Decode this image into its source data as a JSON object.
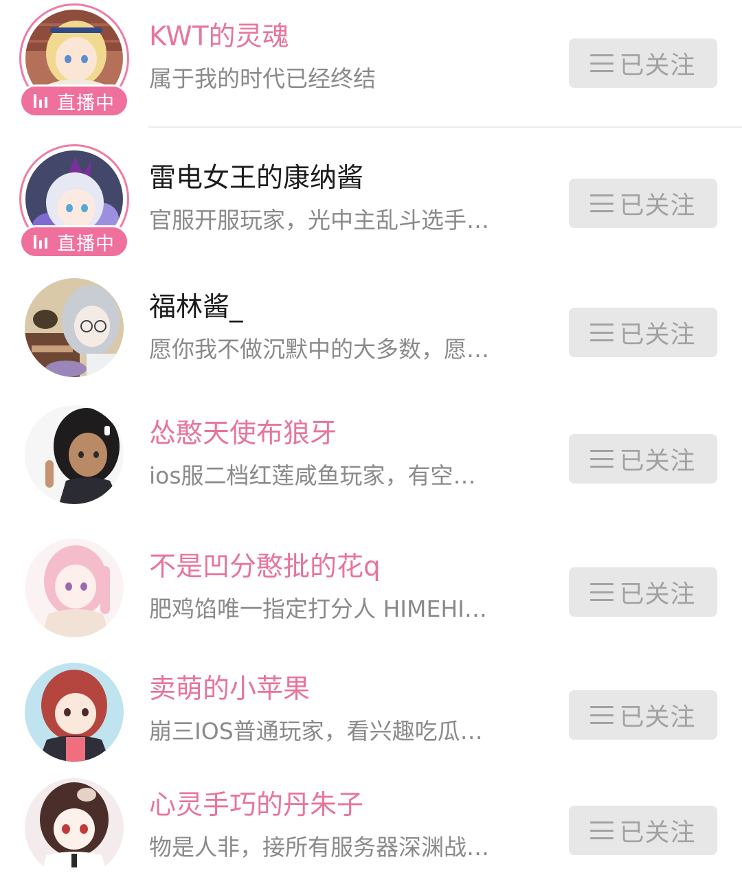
{
  "follow_list": {
    "live_badge_label": "直播中",
    "users": [
      {
        "name": "KWT的灵魂",
        "bio": "属于我的时代已经终结",
        "name_color": "#e8749d",
        "is_live": true,
        "follow_label": "已关注",
        "avatar": "avatar-anime-blonde-girl"
      },
      {
        "name": "雷电女王的康纳酱",
        "bio": "官服开服玩家，光中主乱斗选手…",
        "name_color": "#1c1c1c",
        "is_live": true,
        "follow_label": "已关注",
        "avatar": "avatar-anime-white-hair-girl"
      },
      {
        "name": "福林酱_",
        "bio": "愿你我不做沉默中的大多数，愿…",
        "name_color": "#1c1c1c",
        "is_live": false,
        "follow_label": "已关注",
        "avatar": "avatar-anime-silver-hair-glasses"
      },
      {
        "name": "怂憨天使布狼牙",
        "bio": "ios服二档红莲咸鱼玩家，有空…",
        "name_color": "#e8749d",
        "is_live": false,
        "follow_label": "已关注",
        "avatar": "avatar-anime-dark-skin-girl"
      },
      {
        "name": "不是凹分憨批的花q",
        "bio": "肥鸡馅唯一指定打分人 HIMEHI…",
        "name_color": "#e8749d",
        "is_live": false,
        "follow_label": "已关注",
        "avatar": "avatar-anime-pink-hair-girl"
      },
      {
        "name": "卖萌的小苹果",
        "bio": "崩三IOS普通玩家，看兴趣吃瓜…",
        "name_color": "#e8749d",
        "is_live": false,
        "follow_label": "已关注",
        "avatar": "avatar-anime-red-hair-girl"
      },
      {
        "name": "心灵手巧的丹朱子",
        "bio": "物是人非，接所有服务器深渊战…",
        "name_color": "#e8749d",
        "is_live": false,
        "follow_label": "已关注",
        "avatar": "avatar-anime-brown-hair-girl"
      }
    ]
  }
}
